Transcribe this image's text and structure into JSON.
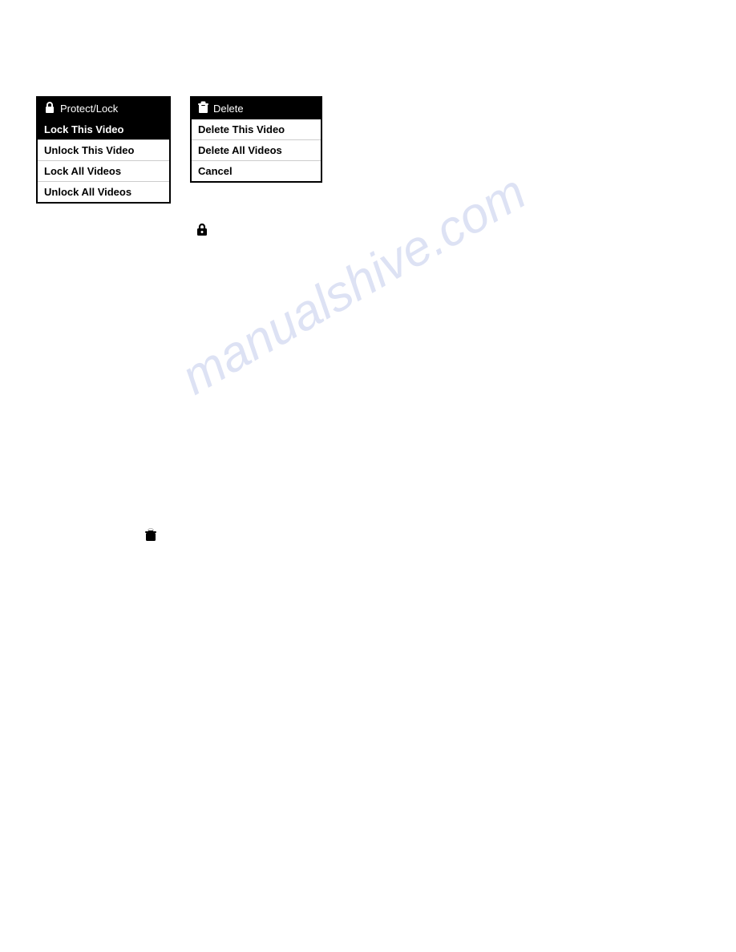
{
  "protect_menu": {
    "header_icon": "lock-icon",
    "header_label": "Protect/Lock",
    "items": [
      {
        "label": "Lock This Video",
        "selected": true
      },
      {
        "label": "Unlock This Video",
        "selected": false
      },
      {
        "label": "Lock All Videos",
        "selected": false
      },
      {
        "label": "Unlock All Videos",
        "selected": false
      }
    ]
  },
  "delete_menu": {
    "header_icon": "trash-icon",
    "header_label": "Delete",
    "items": [
      {
        "label": "Delete This Video",
        "selected": false
      },
      {
        "label": "Delete All Videos",
        "selected": false
      },
      {
        "label": "Cancel",
        "selected": false
      }
    ]
  },
  "lock_icon_label": "🔒",
  "trash_icon_label": "🗑",
  "watermark": {
    "text": "manualshive.com"
  }
}
